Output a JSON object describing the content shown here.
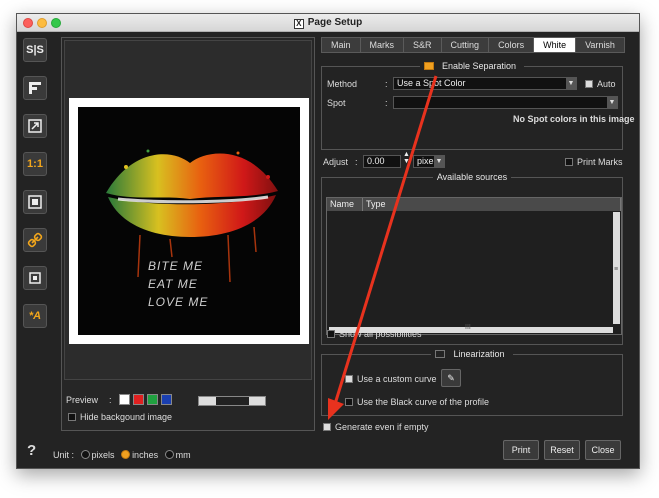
{
  "window": {
    "title": "Page Setup"
  },
  "toolbar": {
    "items": [
      {
        "name": "split-view",
        "glyph": "S|S"
      },
      {
        "name": "align-left",
        "glyph": "▙"
      },
      {
        "name": "fit-page",
        "glyph": "⤢"
      },
      {
        "name": "actual-size",
        "glyph": "1:1"
      },
      {
        "name": "fill-page",
        "glyph": "▣"
      },
      {
        "name": "link",
        "glyph": "🔗"
      },
      {
        "name": "center",
        "glyph": "⌘"
      },
      {
        "name": "text-tool",
        "glyph": "*A"
      }
    ]
  },
  "preview": {
    "label": "Preview",
    "swatches": [
      "#ffffff",
      "#e02020",
      "#20a040",
      "#1a3fb0"
    ],
    "hide_background_label": "Hide backgound image",
    "hide_background_checked": false,
    "artwork_text": [
      "BITE ME",
      "EAT ME",
      "LOVE ME"
    ]
  },
  "tabs": [
    {
      "label": "Main",
      "active": false
    },
    {
      "label": "Marks",
      "active": false
    },
    {
      "label": "S&R",
      "active": false
    },
    {
      "label": "Cutting",
      "active": false
    },
    {
      "label": "Colors",
      "active": false
    },
    {
      "label": "White",
      "active": true
    },
    {
      "label": "Varnish",
      "active": false
    }
  ],
  "separation": {
    "title": "Enable Separation",
    "enabled": true,
    "method_label": "Method",
    "method_value": "Use a Spot Color",
    "auto_label": "Auto",
    "auto_checked": true,
    "spot_label": "Spot",
    "spot_value": "",
    "no_spot_msg": "No Spot colors in this image"
  },
  "adjust": {
    "label": "Adjust",
    "value": "0.00",
    "unit": "pixel",
    "print_marks_label": "Print Marks",
    "print_marks_checked": false
  },
  "sources": {
    "title": "Available sources",
    "columns": [
      "Name",
      "Type"
    ],
    "rows": [],
    "show_all_label": "Show all possibilities",
    "show_all_checked": false
  },
  "linearization": {
    "title": "Linearization",
    "enabled": false,
    "custom_curve_label": "Use a custom curve",
    "custom_curve_checked": true,
    "black_curve_label": "Use the Black curve of the profile",
    "black_curve_checked": false
  },
  "generate_label": "Generate even if empty",
  "generate_checked": true,
  "units": {
    "label": "Unit",
    "options": [
      "pixels",
      "inches",
      "mm"
    ],
    "selected": "inches"
  },
  "help_glyph": "?",
  "buttons": {
    "print": "Print",
    "reset": "Reset",
    "close": "Close"
  },
  "annotation": {
    "arrow_color": "#e8321e"
  }
}
